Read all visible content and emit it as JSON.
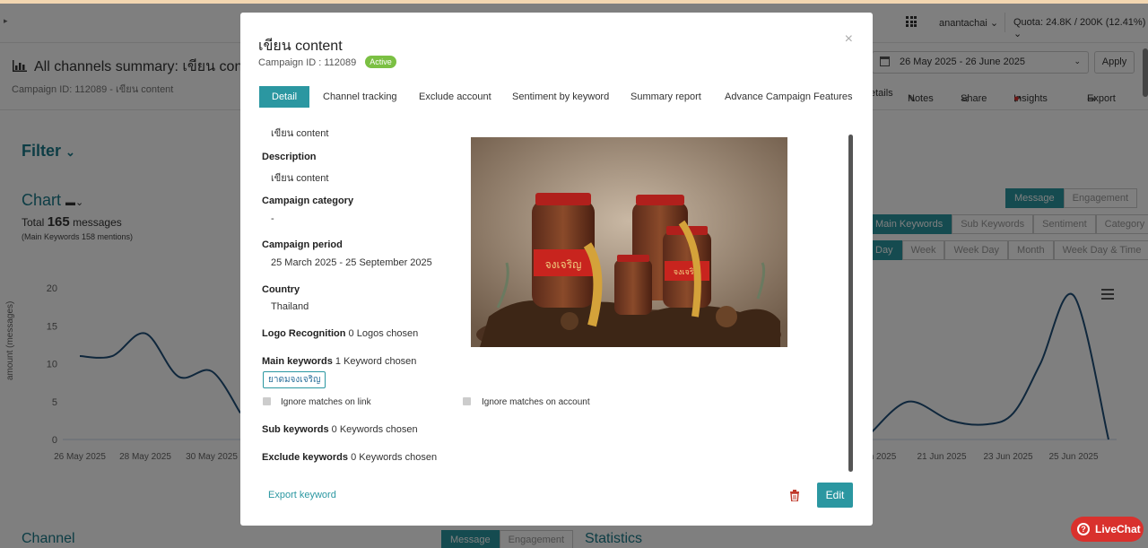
{
  "topbar": {
    "user": "anantachai",
    "quota": "Quota: 24.8K / 200K (12.41%)"
  },
  "page": {
    "title": "All channels summary: เขียน conte",
    "subtitle": "Campaign ID: 112089 - เขียน content",
    "date_range": "26 May 2025 - 26 June 2025",
    "apply_label": "Apply",
    "actions": {
      "details": "etails",
      "notes": "Notes",
      "share": "Share",
      "insights": "Insights",
      "export": "Export"
    },
    "filter_label": "Filter",
    "chart_label": "Chart",
    "total_prefix": "Total",
    "total_count": "165",
    "total_suffix": "messages",
    "main_keywords_note": "(Main Keywords 158 mentions)",
    "metric_buttons": [
      "Message",
      "Engagement"
    ],
    "keyword_buttons": [
      "Main Keywords",
      "Sub Keywords",
      "Sentiment",
      "Category"
    ],
    "period_buttons": [
      "Day",
      "Week",
      "Week Day",
      "Month",
      "Week Day & Time"
    ],
    "channel_label": "Channel",
    "statistics_label": "Statistics",
    "bottom_buttons": [
      "Message",
      "Engagement"
    ],
    "livechat_label": "LiveChat"
  },
  "chart_data": {
    "type": "line",
    "ylabel": "amount (messages)",
    "ylim": [
      0,
      20
    ],
    "yticks": [
      "0",
      "5",
      "10",
      "15",
      "20"
    ],
    "xticks_left": [
      "26 May 2025",
      "28 May 2025",
      "30 May 2025"
    ],
    "xticks_right": [
      "n 2025",
      "21 Jun 2025",
      "23 Jun 2025",
      "25 Jun 2025"
    ],
    "series": [
      {
        "visible_left": [
          11,
          11,
          14,
          8.3,
          9,
          3.5
        ],
        "visible_right": [
          1,
          5,
          2.5,
          2,
          3.5,
          10,
          19,
          0
        ]
      }
    ],
    "color": "#1f4e79"
  },
  "modal": {
    "title": "เขียน content",
    "campaign_id": "Campaign ID : 112089",
    "status_badge": "Active",
    "close": "×",
    "tabs": [
      "Detail",
      "Channel tracking",
      "Exclude account",
      "Sentiment by keyword",
      "Summary report",
      "Advance Campaign Features"
    ],
    "name_value": "เขียน content",
    "description_label": "Description",
    "description_value": "เขียน content",
    "category_label": "Campaign category",
    "category_value": "-",
    "period_label": "Campaign period",
    "period_value": "25 March 2025 - 25 September 2025",
    "country_label": "Country",
    "country_value": "Thailand",
    "logo_label": "Logo Recognition",
    "logo_value": "0 Logos chosen",
    "main_kw_label": "Main keywords",
    "main_kw_value": "1 Keyword chosen",
    "main_kw_tag": "ยาดมจงเจริญ",
    "ignore_link": "Ignore matches on link",
    "ignore_account": "Ignore matches on account",
    "sub_kw_label": "Sub keywords",
    "sub_kw_value": "0 Keywords chosen",
    "exclude_kw_label": "Exclude keywords",
    "exclude_kw_value": "0 Keywords chosen",
    "export_keyword": "Export keyword",
    "edit_label": "Edit"
  }
}
